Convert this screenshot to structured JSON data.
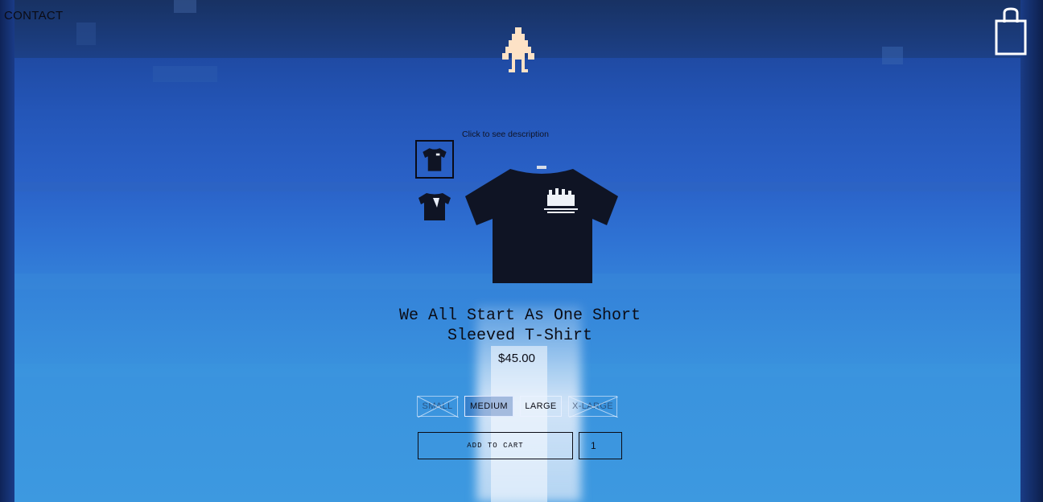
{
  "nav": {
    "contact_label": "CONTACT"
  },
  "icons": {
    "logo": "pixel-figure-icon",
    "cart": "shopping-bag-icon"
  },
  "gallery": {
    "hint": "Click to see description",
    "thumbnails": [
      "front-view",
      "back-view"
    ]
  },
  "product": {
    "title_line1": "We All Start As One Short",
    "title_line2": "Sleeved T-Shirt",
    "price": "$45.00"
  },
  "sizes": [
    {
      "label": "SMALL",
      "available": false,
      "selected": false
    },
    {
      "label": "MEDIUM",
      "available": true,
      "selected": true
    },
    {
      "label": "LARGE",
      "available": true,
      "selected": false
    },
    {
      "label": "X-LARGE",
      "available": false,
      "selected": false
    }
  ],
  "cart": {
    "add_label": "ADD TO CART",
    "quantity": "1"
  },
  "colors": {
    "text": "#0b0c15",
    "background_top": "#1d3f86",
    "background_bottom": "#3d99e0",
    "shirt": "#0f1424"
  }
}
